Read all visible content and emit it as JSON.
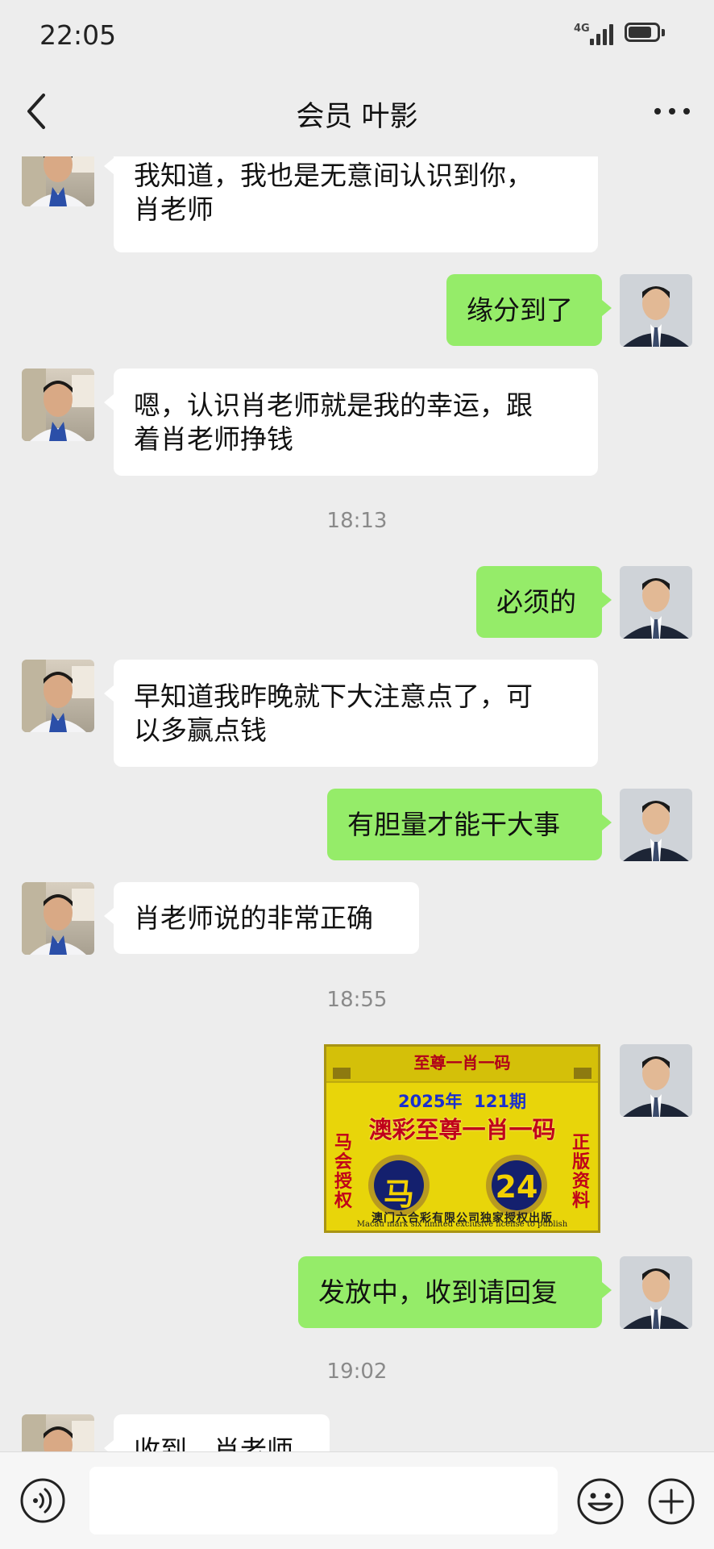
{
  "status_bar": {
    "time": "22:05",
    "network": "4G",
    "icons": [
      "signal-bars-icon",
      "battery-icon"
    ]
  },
  "header": {
    "title": "会员 叶影",
    "icons": [
      "back-arrow-icon",
      "more-dots-icon"
    ]
  },
  "messages": [
    {
      "side": "left",
      "text_lines": [
        "我知道，我也是无意间认识到你，",
        "肖老师"
      ]
    },
    {
      "side": "right",
      "text_lines": [
        "缘分到了"
      ]
    },
    {
      "side": "left",
      "text_lines": [
        "嗯，认识肖老师就是我的幸运，跟",
        "着肖老师挣钱"
      ]
    },
    {
      "side": "right",
      "text_lines": [
        "必须的"
      ]
    },
    {
      "side": "left",
      "text_lines": [
        "早知道我昨晚就下大注意点了，可",
        "以多赢点钱"
      ]
    },
    {
      "side": "right",
      "text_lines": [
        "有胆量才能干大事"
      ]
    },
    {
      "side": "left",
      "text_lines": [
        "肖老师说的非常正确"
      ]
    },
    {
      "side": "right",
      "text_lines": [
        "发放中，收到请回复"
      ]
    },
    {
      "side": "left",
      "text_lines": [
        "收到，肖老师"
      ]
    }
  ],
  "timestamps": [
    "18:13",
    "18:55",
    "19:02"
  ],
  "image_message": {
    "header": "至尊一肖一码",
    "period": "2025年  121期",
    "headline": "澳彩至尊一肖一码",
    "left_chars": [
      "马",
      "会",
      "授",
      "权"
    ],
    "right_chars": [
      "正",
      "版",
      "资",
      "料"
    ],
    "zodiac": "马",
    "number": "24",
    "footer_cn": "澳门六合彩有限公司独家授权出版",
    "footer_en": "Macau mark six limited exclusive license to publish",
    "colors": {
      "background": "#e8d50a",
      "headline": "#c0001a",
      "period": "#1a2fcf",
      "circle": "#14206e"
    }
  },
  "input_bar": {
    "value": "",
    "icons": [
      "voice-icon",
      "emoji-icon",
      "plus-icon"
    ]
  },
  "colors": {
    "background": "#ededed",
    "bubble_self": "#95ec69",
    "bubble_other": "#ffffff",
    "timestamp": "#8a8a8a"
  }
}
